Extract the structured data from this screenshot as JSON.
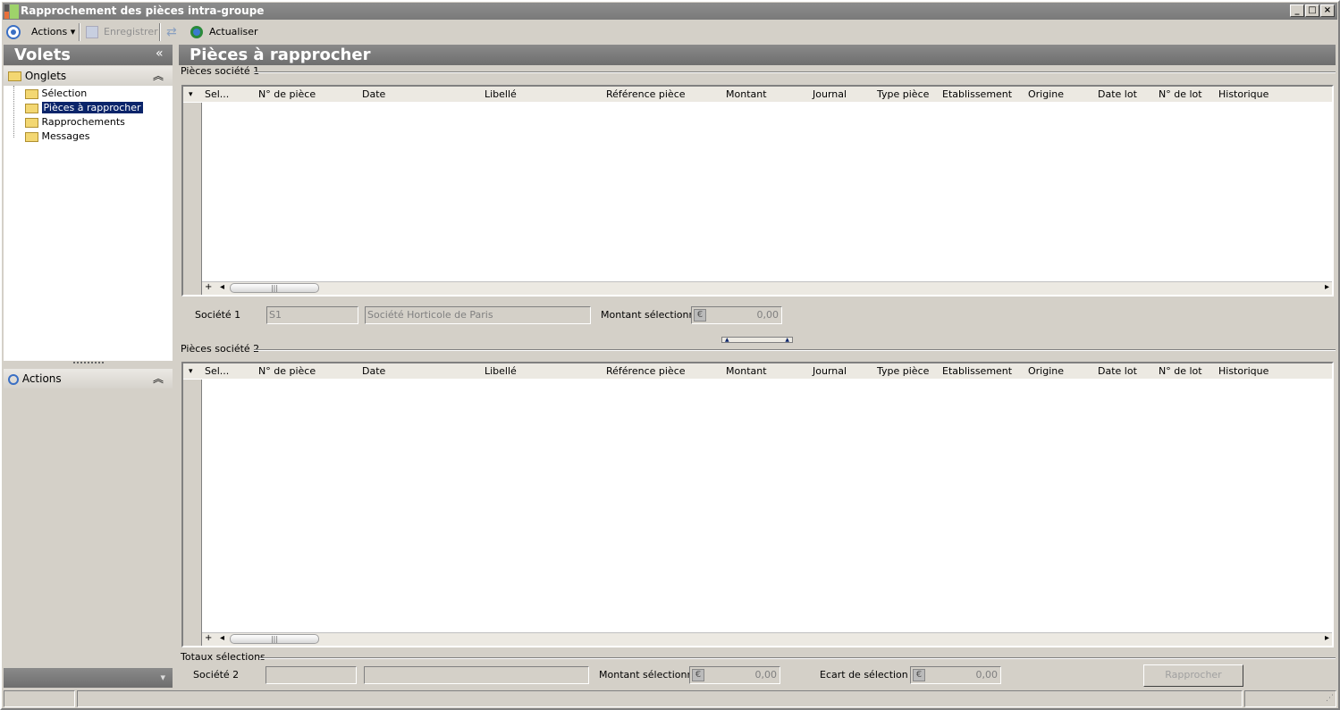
{
  "window": {
    "title": "Rapprochement des pièces intra-groupe",
    "minimize": "_",
    "maximize": "□",
    "close": "×"
  },
  "toolbar": {
    "actions": "Actions",
    "save": "Enregistrer",
    "refresh": "Actualiser"
  },
  "left": {
    "title": "Volets",
    "collapse": "«",
    "tabs_header": "Onglets",
    "tabs": [
      "Sélection",
      "Pièces à rapprocher",
      "Rapprochements",
      "Messages"
    ],
    "selected_index": 1,
    "actions_header": "Actions",
    "expand": "»"
  },
  "main": {
    "title": "Pièces à rapprocher",
    "group1": "Pièces société 1",
    "group2": "Pièces société 2",
    "totals": "Totaux sélections",
    "columns": [
      "Sel...",
      "N° de pièce",
      "Date",
      "Libellé",
      "Référence pièce",
      "Montant",
      "Journal",
      "Type pièce",
      "Etablissement",
      "Origine",
      "Date lot",
      "N° de lot",
      "Historique"
    ],
    "company1": {
      "label": "Société 1",
      "code": "S1",
      "name": "Société Horticole de Paris",
      "amount_label": "Montant sélectionné",
      "amount": "0,00"
    },
    "company2": {
      "label": "Société 2",
      "code": "",
      "name": "",
      "amount_label": "Montant sélectionné",
      "amount": "0,00",
      "gap_label": "Ecart de sélection",
      "gap": "0,00"
    },
    "reconcile_button": "Rapprocher"
  },
  "icons": {
    "euro": "€",
    "plus": "+",
    "left": "◂",
    "right": "▸",
    "dropdown": "▾"
  }
}
